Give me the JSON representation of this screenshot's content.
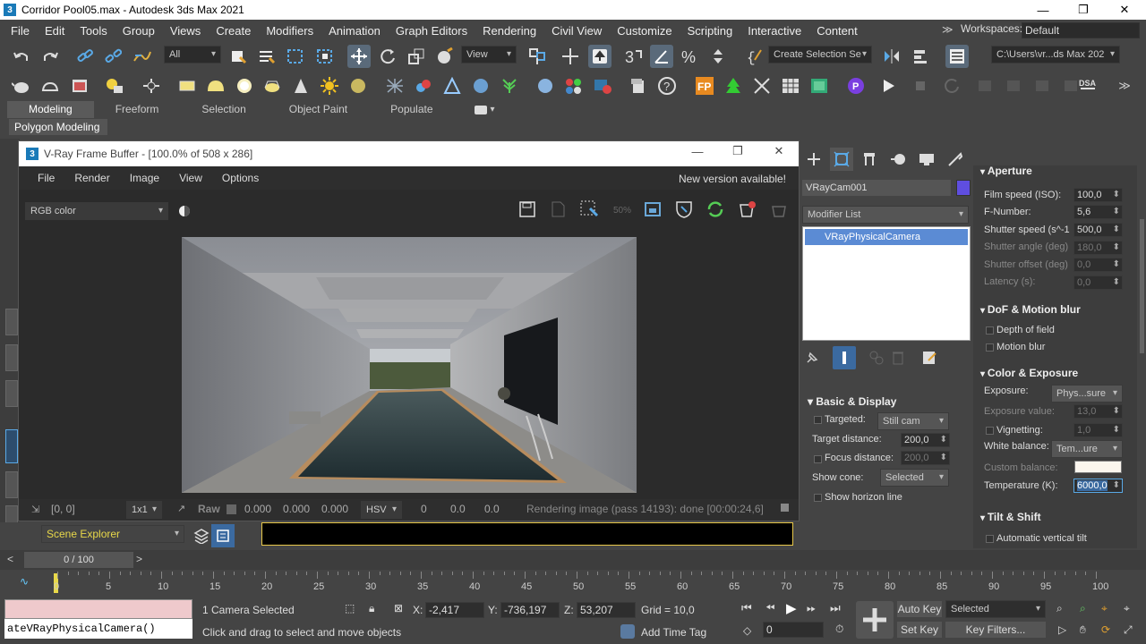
{
  "window": {
    "title": "Corridor Pool05.max - Autodesk 3ds Max 2021",
    "logo": "3",
    "minimize": "—",
    "maximize": "❐",
    "close": "✕"
  },
  "menu": [
    "File",
    "Edit",
    "Tools",
    "Group",
    "Views",
    "Create",
    "Modifiers",
    "Animation",
    "Graph Editors",
    "Rendering",
    "Civil View",
    "Customize",
    "Scripting",
    "Interactive",
    "Content"
  ],
  "workspace": {
    "label": "Workspaces:",
    "value": "Default",
    "more": "≫"
  },
  "toolbar1": {
    "filter": "All",
    "view": "View",
    "selection_set": "Create Selection Se",
    "path": "C:\\Users\\vr...ds Max 202"
  },
  "ribbon": {
    "tabs": [
      "Modeling",
      "Freeform",
      "Selection",
      "Object Paint",
      "Populate"
    ],
    "active": "Modeling",
    "sub": "Polygon Modeling"
  },
  "vfb": {
    "title": "V-Ray Frame Buffer - [100.0% of 508 x 286]",
    "logo": "3",
    "menu": [
      "File",
      "Render",
      "Image",
      "View",
      "Options"
    ],
    "new_version": "New version available!",
    "channel": "RGB color",
    "status": {
      "coords": "[0, 0]",
      "ratio": "1x1",
      "raw": "Raw",
      "r": "0.000",
      "g": "0.000",
      "b": "0.000",
      "mode": "HSV",
      "h": "0",
      "s": "0.0",
      "v": "0.0",
      "message": "Rendering image (pass 14193): done [00:00:24,6]"
    }
  },
  "command_panel": {
    "object_name": "VRayCam001",
    "object_color": "#5f4ee0",
    "modifier_list": "Modifier List",
    "stack_item": "VRayPhysicalCamera",
    "basic_display": {
      "title": "Basic & Display",
      "targeted": "Targeted:",
      "targeted_val": "Still cam",
      "target_distance": "Target distance:",
      "target_distance_val": "200,0",
      "focus_distance": "Focus distance:",
      "focus_distance_val": "200,0",
      "show_cone": "Show cone:",
      "show_cone_val": "Selected",
      "show_horizon": "Show horizon line"
    }
  },
  "rollout": {
    "aperture": {
      "title": "Aperture",
      "film_speed": "Film speed (ISO):",
      "film_speed_val": "100,0",
      "f_number": "F-Number:",
      "f_number_val": "5,6",
      "shutter_speed": "Shutter speed (s^-1",
      "shutter_speed_val": "500,0",
      "shutter_angle": "Shutter angle (deg)",
      "shutter_angle_val": "180,0",
      "shutter_offset": "Shutter offset (deg)",
      "shutter_offset_val": "0,0",
      "latency": "Latency (s):",
      "latency_val": "0,0"
    },
    "dof": {
      "title": "DoF & Motion blur",
      "depth": "Depth of field",
      "motion": "Motion blur"
    },
    "color": {
      "title": "Color & Exposure",
      "exposure": "Exposure:",
      "exposure_val": "Phys...sure",
      "exposure_value": "Exposure value:",
      "exposure_value_val": "13,0",
      "vignetting": "Vignetting:",
      "vignetting_val": "1,0",
      "white_balance": "White balance:",
      "white_balance_val": "Tem...ure",
      "custom_balance": "Custom balance:",
      "temperature": "Temperature (K):",
      "temperature_val": "6000,0"
    },
    "tilt": {
      "title": "Tilt & Shift",
      "auto": "Automatic vertical tilt"
    }
  },
  "scene_explorer": "Scene Explorer",
  "timeline": {
    "frame": "0 / 100",
    "prev": "<",
    "next": ">",
    "ticks": [
      "0",
      "5",
      "10",
      "15",
      "20",
      "25",
      "30",
      "35",
      "40",
      "45",
      "50",
      "55",
      "60",
      "65",
      "70",
      "75",
      "80",
      "85",
      "90",
      "95",
      "100"
    ]
  },
  "status": {
    "maxscript": "ateVRayPhysicalCamera()",
    "selected": "1 Camera Selected",
    "hint": "Click and drag to select and move objects",
    "x_label": "X:",
    "x": "-2,417",
    "y_label": "Y:",
    "y": "-736,197",
    "z_label": "Z:",
    "z": "53,207",
    "grid": "Grid = 10,0",
    "add_time_tag": "Add Time Tag",
    "auto_key": "Auto Key",
    "set_key": "Set Key",
    "key_mode": "Selected",
    "key_filters": "Key Filters...",
    "frame_field": "0"
  }
}
